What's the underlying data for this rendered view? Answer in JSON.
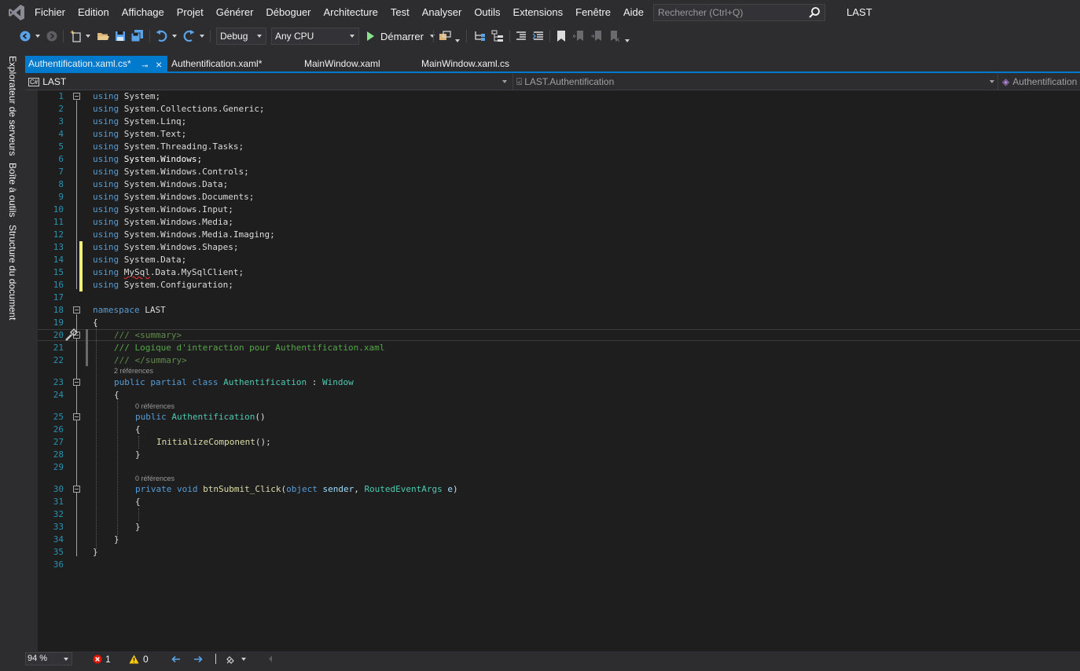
{
  "menu": {
    "items": [
      "Fichier",
      "Edition",
      "Affichage",
      "Projet",
      "Générer",
      "Déboguer",
      "Architecture",
      "Test",
      "Analyser",
      "Outils",
      "Extensions",
      "Fenêtre",
      "Aide"
    ],
    "search_placeholder": "Rechercher (Ctrl+Q)",
    "solution_name": "LAST"
  },
  "toolbar": {
    "configuration": "Debug",
    "platform": "Any CPU",
    "start_label": "Démarrer"
  },
  "side_tabs": [
    "Explorateur de serveurs",
    "Boîte à outils",
    "Structure du document"
  ],
  "tabs": [
    {
      "label": "Authentification.xaml.cs*",
      "active": true
    },
    {
      "label": "Authentification.xaml*",
      "active": false
    },
    {
      "label": "MainWindow.xaml",
      "active": false
    },
    {
      "label": "MainWindow.xaml.cs",
      "active": false
    }
  ],
  "navbar": {
    "project": "LAST",
    "type": "LAST.Authentification",
    "member": "Authentification"
  },
  "code": {
    "line_numbers": [
      "1",
      "2",
      "3",
      "4",
      "5",
      "6",
      "7",
      "8",
      "9",
      "10",
      "11",
      "12",
      "13",
      "14",
      "15",
      "16",
      "17",
      "18",
      "19",
      "20",
      "21",
      "22",
      "23",
      "24",
      "25",
      "26",
      "27",
      "28",
      "29",
      "30",
      "31",
      "32",
      "33",
      "34",
      "35",
      "36"
    ],
    "kw_using": "using",
    "usings": [
      "System;",
      "System.Collections.Generic;",
      "System.Linq;",
      "System.Text;",
      "System.Threading.Tasks;",
      "System.Windows;",
      "System.Windows.Controls;",
      "System.Windows.Data;",
      "System.Windows.Documents;",
      "System.Windows.Input;",
      "System.Windows.Media;",
      "System.Windows.Media.Imaging;",
      "System.Windows.Shapes;",
      "System.Data;"
    ],
    "mysql_first": "MySql",
    "mysql_rest": ".Data.MySqlClient;",
    "using_last": "System.Configuration;",
    "kw_namespace": "namespace",
    "namespace_name": " LAST",
    "brace_open": "{",
    "brace_close": "}",
    "doc_summary_open_slashes": "/// ",
    "doc_summary_open_tag": "<summary>",
    "doc_line": "/// Logique d'interaction pour Authentification.xaml",
    "doc_summary_close_slashes": "/// ",
    "doc_summary_close_tag": "</summary>",
    "lens_class": "2 références",
    "kw_public": "public",
    "kw_partial": "partial",
    "kw_class": "class",
    "class_name": "Authentification",
    "colon": " : ",
    "base_class": "Window",
    "lens_ctor": "0 références",
    "ctor_name": "Authentification",
    "ctor_parens": "()",
    "init_call": "InitializeComponent",
    "init_tail": "();",
    "lens_method": "0 références",
    "kw_private": "private",
    "kw_void": "void",
    "method_name": "btnSubmit_Click",
    "paren_open": "(",
    "kw_object": "object",
    "param_sender": " sender",
    "comma": ", ",
    "type_args": "RoutedEventArgs",
    "param_e": " e",
    "paren_close": ")"
  },
  "status": {
    "zoom": "94 %",
    "errors": "1",
    "warnings": "0"
  },
  "colors": {
    "accent": "#007acc",
    "keyword": "#569cd6",
    "type": "#4ec9b0",
    "comment": "#57a64a",
    "change_marker": "#efef7a",
    "line_number": "#2b91af"
  }
}
